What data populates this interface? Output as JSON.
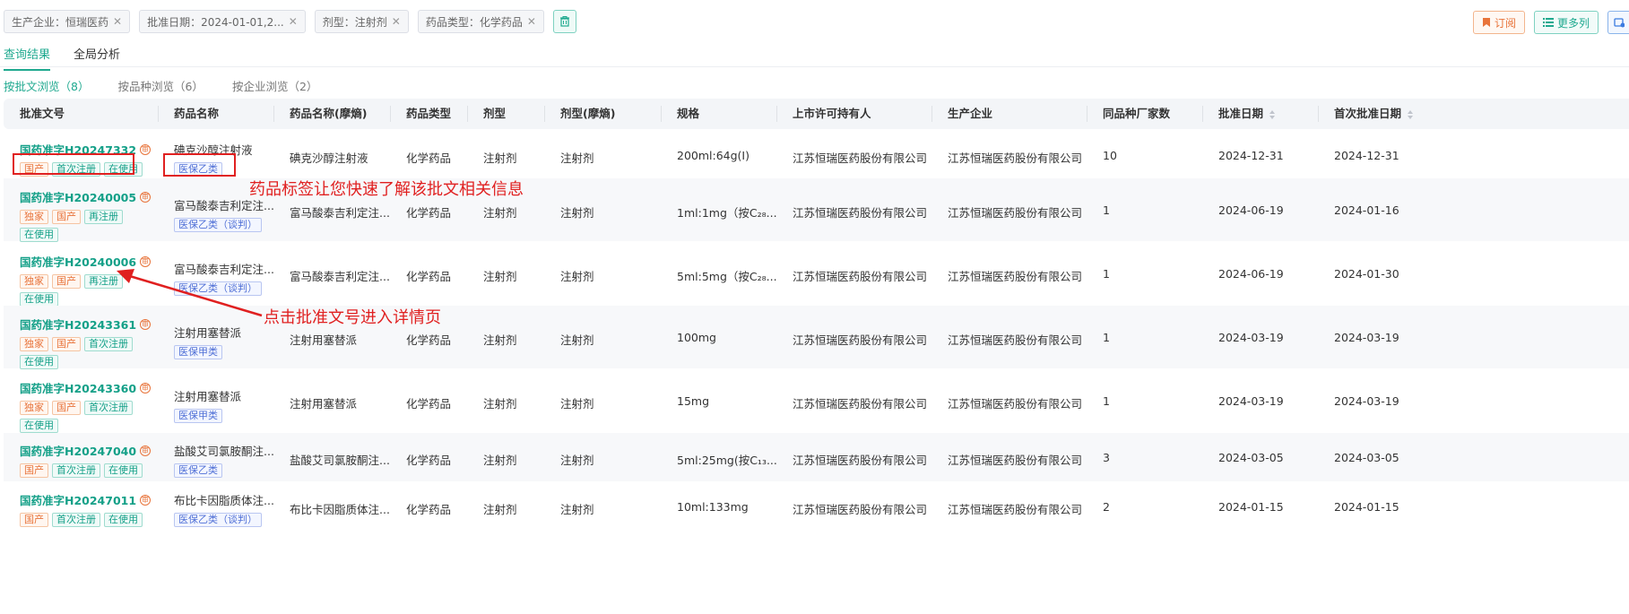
{
  "filters": [
    {
      "label": "生产企业：恒瑞医药"
    },
    {
      "label": "批准日期：2024-01-01,2..."
    },
    {
      "label": "剂型：注射剂"
    },
    {
      "label": "药品类型：化学药品"
    }
  ],
  "actions": {
    "subscribe": "订阅",
    "more_columns": "更多列"
  },
  "tabs": [
    {
      "label": "查询结果",
      "active": true
    },
    {
      "label": "全局分析",
      "active": false
    }
  ],
  "subtabs": [
    {
      "label": "按批文浏览（8）",
      "active": true
    },
    {
      "label": "按品种浏览（6）",
      "active": false
    },
    {
      "label": "按企业浏览（2）",
      "active": false
    }
  ],
  "columns": [
    "批准文号",
    "药品名称",
    "药品名称(摩熵)",
    "药品类型",
    "剂型",
    "剂型(摩熵)",
    "规格",
    "上市许可持有人",
    "生产企业",
    "同品种厂家数",
    "批准日期",
    "首次批准日期"
  ],
  "rows": [
    {
      "approval": "国药准字H20247332",
      "tags": [
        "国产",
        "首次注册",
        "在使用"
      ],
      "name": "碘克沙醇注射液",
      "ins": "医保乙类",
      "name_ms": "碘克沙醇注射液",
      "type": "化学药品",
      "form": "注射剂",
      "form_ms": "注射剂",
      "spec": "200ml:64g(I)",
      "holder": "江苏恒瑞医药股份有限公司",
      "maker": "江苏恒瑞医药股份有限公司",
      "count": "10",
      "date": "2024-12-31",
      "first": "2024-12-31"
    },
    {
      "approval": "国药准字H20240005",
      "tags": [
        "独家",
        "国产",
        "再注册",
        "在使用"
      ],
      "name": "富马酸泰吉利定注...",
      "ins": "医保乙类（谈判）",
      "name_ms": "富马酸泰吉利定注...",
      "type": "化学药品",
      "form": "注射剂",
      "form_ms": "注射剂",
      "spec": "1ml:1mg（按C₂₈...",
      "holder": "江苏恒瑞医药股份有限公司",
      "maker": "江苏恒瑞医药股份有限公司",
      "count": "1",
      "date": "2024-06-19",
      "first": "2024-01-16"
    },
    {
      "approval": "国药准字H20240006",
      "tags": [
        "独家",
        "国产",
        "再注册",
        "在使用"
      ],
      "name": "富马酸泰吉利定注...",
      "ins": "医保乙类（谈判）",
      "name_ms": "富马酸泰吉利定注...",
      "type": "化学药品",
      "form": "注射剂",
      "form_ms": "注射剂",
      "spec": "5ml:5mg（按C₂₈...",
      "holder": "江苏恒瑞医药股份有限公司",
      "maker": "江苏恒瑞医药股份有限公司",
      "count": "1",
      "date": "2024-06-19",
      "first": "2024-01-30"
    },
    {
      "approval": "国药准字H20243361",
      "tags": [
        "独家",
        "国产",
        "首次注册",
        "在使用"
      ],
      "name": "注射用塞替派",
      "ins": "医保甲类",
      "name_ms": "注射用塞替派",
      "type": "化学药品",
      "form": "注射剂",
      "form_ms": "注射剂",
      "spec": "100mg",
      "holder": "江苏恒瑞医药股份有限公司",
      "maker": "江苏恒瑞医药股份有限公司",
      "count": "1",
      "date": "2024-03-19",
      "first": "2024-03-19"
    },
    {
      "approval": "国药准字H20243360",
      "tags": [
        "独家",
        "国产",
        "首次注册",
        "在使用"
      ],
      "name": "注射用塞替派",
      "ins": "医保甲类",
      "name_ms": "注射用塞替派",
      "type": "化学药品",
      "form": "注射剂",
      "form_ms": "注射剂",
      "spec": "15mg",
      "holder": "江苏恒瑞医药股份有限公司",
      "maker": "江苏恒瑞医药股份有限公司",
      "count": "1",
      "date": "2024-03-19",
      "first": "2024-03-19"
    },
    {
      "approval": "国药准字H20247040",
      "tags": [
        "国产",
        "首次注册",
        "在使用"
      ],
      "name": "盐酸艾司氯胺酮注...",
      "ins": "医保乙类",
      "name_ms": "盐酸艾司氯胺酮注...",
      "type": "化学药品",
      "form": "注射剂",
      "form_ms": "注射剂",
      "spec": "5ml:25mg(按C₁₃...",
      "holder": "江苏恒瑞医药股份有限公司",
      "maker": "江苏恒瑞医药股份有限公司",
      "count": "3",
      "date": "2024-03-05",
      "first": "2024-03-05"
    },
    {
      "approval": "国药准字H20247011",
      "tags": [
        "国产",
        "首次注册",
        "在使用"
      ],
      "name": "布比卡因脂质体注...",
      "ins": "医保乙类（谈判）",
      "name_ms": "布比卡因脂质体注...",
      "type": "化学药品",
      "form": "注射剂",
      "form_ms": "注射剂",
      "spec": "10ml:133mg",
      "holder": "江苏恒瑞医药股份有限公司",
      "maker": "江苏恒瑞医药股份有限公司",
      "count": "2",
      "date": "2024-01-15",
      "first": "2024-01-15"
    }
  ],
  "annotations": {
    "tag_note": "药品标签让您快速了解该批文相关信息",
    "click_note": "点击批准文号进入详情页"
  },
  "colors": {
    "accent": "#14a088",
    "orange": "#e8743b",
    "blue": "#4f6fd6",
    "annotation": "#e02020"
  }
}
